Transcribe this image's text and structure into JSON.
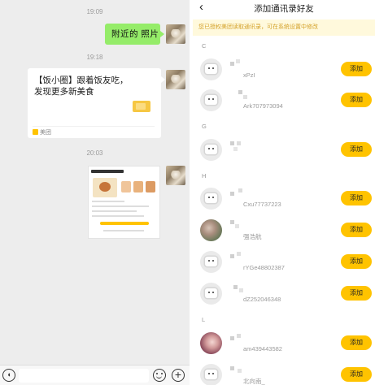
{
  "chat": {
    "timestamps": [
      "19:09",
      "19:18",
      "20:03"
    ],
    "green_message": "附近的 照片",
    "card": {
      "title": "【饭小圈】跟着饭友吃，发现更多新美食",
      "source": "美团"
    }
  },
  "contacts": {
    "header": {
      "back_icon": "back-arrow-icon",
      "title": "添加通讯录好友"
    },
    "notice": "您已授权美团读取通讯录，可在系统设置中修改",
    "sections": [
      {
        "letter": "C",
        "items": [
          {
            "id": "xPzI",
            "avatar": "robot",
            "button": "添加"
          },
          {
            "id": "Ark707973094",
            "avatar": "robot",
            "button": "添加"
          }
        ]
      },
      {
        "letter": "G",
        "items": [
          {
            "id": "",
            "avatar": "robot",
            "button": "添加"
          }
        ]
      },
      {
        "letter": "H",
        "items": [
          {
            "id": "Cxu77737223",
            "avatar": "robot",
            "button": "添加"
          },
          {
            "id": "强浩航",
            "avatar": "photo",
            "button": "添加"
          },
          {
            "id": "rYGe48802387",
            "avatar": "robot",
            "button": "添加"
          },
          {
            "id": "dZ252046348",
            "avatar": "robot",
            "button": "添加"
          }
        ]
      },
      {
        "letter": "L",
        "items": [
          {
            "id": "am439443582",
            "avatar": "photo",
            "button": "添加"
          },
          {
            "id": "北向南_",
            "avatar": "robot",
            "button": "添加"
          }
        ]
      }
    ]
  },
  "colors": {
    "accent": "#ffc300",
    "chat_bubble": "#95ec69",
    "notice_text": "#d4a22b"
  }
}
